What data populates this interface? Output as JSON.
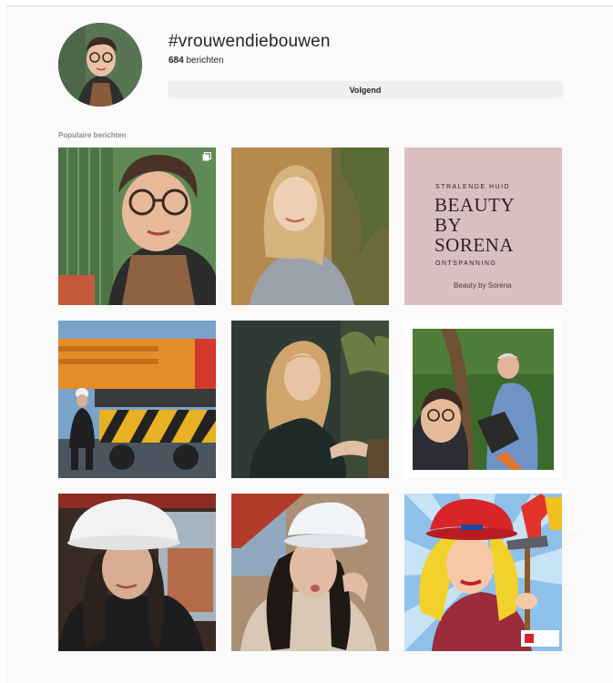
{
  "header": {
    "hashtag": "#vrouwendiebouwen",
    "post_count": "684",
    "post_count_suffix": " berichten",
    "follow_label": "Volgend"
  },
  "section": {
    "popular_label": "Populaire berichten"
  },
  "beauty_post": {
    "top_line": "STRALENDE HUID",
    "title": "BEAUTY\nBY\nSORENA",
    "bottom_line": "ONTSPANNING",
    "signature": "Beauty by Sorena"
  },
  "icons": {
    "multi_post": "multiple-posts-icon"
  }
}
